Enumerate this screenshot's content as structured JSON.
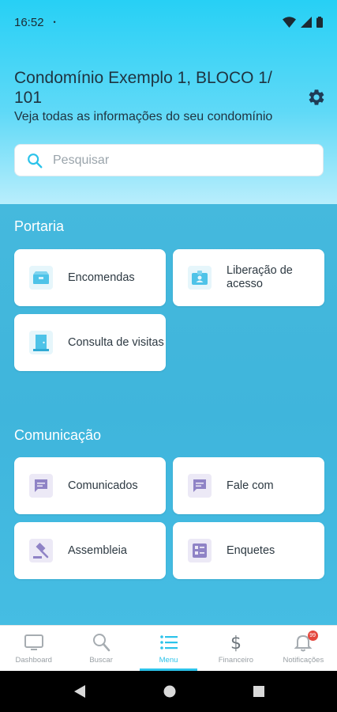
{
  "status": {
    "time": "16:52",
    "dot": "•"
  },
  "header": {
    "title": "Condomínio Exemplo 1, BLOCO 1/ 101",
    "subtitle": "Veja todas as informações do seu condomínio"
  },
  "search": {
    "placeholder": "Pesquisar"
  },
  "sections": {
    "portaria": {
      "title": "Portaria",
      "items": [
        {
          "label": "Encomendas",
          "icon": "package-icon"
        },
        {
          "label": "Liberação de acesso",
          "icon": "badge-icon"
        },
        {
          "label": "Consulta de visitas",
          "icon": "door-icon"
        }
      ]
    },
    "comunicacao": {
      "title": "Comunicação",
      "items": [
        {
          "label": "Comunicados",
          "icon": "message-icon"
        },
        {
          "label": "Fale com",
          "icon": "message-icon"
        },
        {
          "label": "Assembleia",
          "icon": "gavel-icon"
        },
        {
          "label": "Enquetes",
          "icon": "poll-icon"
        }
      ]
    }
  },
  "bottom_nav": {
    "items": [
      {
        "label": "Dashboard",
        "icon": "monitor-icon"
      },
      {
        "label": "Buscar",
        "icon": "search-icon"
      },
      {
        "label": "Menu",
        "icon": "list-icon"
      },
      {
        "label": "Financeiro",
        "icon": "dollar-icon"
      },
      {
        "label": "Notificações",
        "icon": "bell-icon",
        "badge": "99"
      }
    ],
    "active": "Menu"
  },
  "colors": {
    "accent": "#2cc3ea",
    "header_top": "#27d0f5",
    "main_bg": "#3fb5dc",
    "icon_teal": "#4ec3e8",
    "icon_purple": "#8f83c6",
    "badge": "#e4473d"
  }
}
